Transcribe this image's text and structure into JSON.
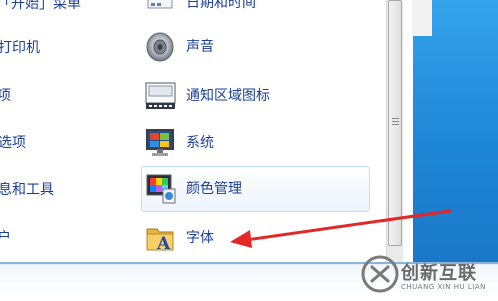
{
  "control_panel": {
    "items": [
      {
        "label": "「开始」菜单"
      },
      {
        "label": "日期和时间"
      },
      {
        "label": "打印机"
      },
      {
        "label": "声音"
      },
      {
        "label": "项"
      },
      {
        "label": "通知区域图标"
      },
      {
        "label": "选项"
      },
      {
        "label": "系统"
      },
      {
        "label": "息和工具"
      },
      {
        "label": "颜色管理"
      },
      {
        "label": "户"
      },
      {
        "label": "字体"
      }
    ]
  },
  "icons": {
    "calendar": "calendar-icon",
    "sound": "speaker-icon",
    "notify": "notification-area-icon",
    "system": "system-monitor-icon",
    "color": "color-management-icon",
    "fonts": "fonts-folder-icon"
  },
  "watermark": {
    "text": "创新互联",
    "subtext": "CHUANG XIN HU LIAN"
  },
  "colors": {
    "link": "#1a3f99",
    "desktop_blue": "#1e86d6",
    "arrow": "#e32626"
  }
}
